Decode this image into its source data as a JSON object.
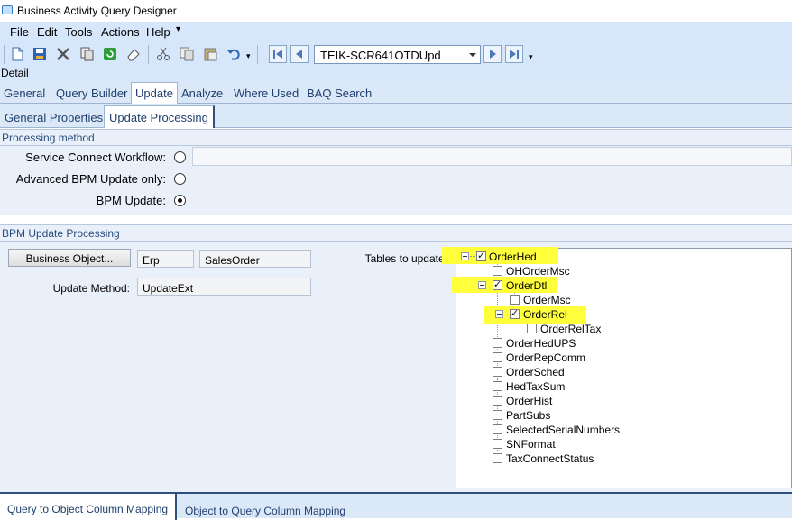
{
  "window": {
    "title": "Business Activity Query Designer"
  },
  "menu": [
    "File",
    "Edit",
    "Tools",
    "Actions",
    "Help"
  ],
  "toolbar": {
    "query_id": "TEIK-SCR641OTDUpd"
  },
  "detail_label": "Detail",
  "main_tabs": [
    "General",
    "Query Builder",
    "Update",
    "Analyze",
    "Where Used",
    "BAQ Search"
  ],
  "active_main_tab": "Update",
  "sub_tabs": [
    "General Properties",
    "Update Processing"
  ],
  "active_sub_tab": "Update Processing",
  "processing_method": {
    "header": "Processing method",
    "service_connect_label": "Service Connect Workflow:",
    "advanced_bpm_label": "Advanced BPM Update only:",
    "bpm_update_label": "BPM Update:",
    "selected": "BPM Update"
  },
  "bpm_update": {
    "header": "BPM Update Processing",
    "business_object_button": "Business Object...",
    "bo_namespace": "Erp",
    "bo_name": "SalesOrder",
    "update_method_label": "Update Method:",
    "update_method": "UpdateExt",
    "tables_label": "Tables to update:"
  },
  "tree": [
    {
      "label": "OrderHed",
      "checked": true,
      "highlight": true
    },
    {
      "label": "OHOrderMsc",
      "checked": false
    },
    {
      "label": "OrderDtl",
      "checked": true,
      "highlight": true
    },
    {
      "label": "OrderMsc",
      "checked": false
    },
    {
      "label": "OrderRel",
      "checked": true,
      "highlight": true
    },
    {
      "label": "OrderRelTax",
      "checked": false
    },
    {
      "label": "OrderHedUPS",
      "checked": false
    },
    {
      "label": "OrderRepComm",
      "checked": false
    },
    {
      "label": "OrderSched",
      "checked": false
    },
    {
      "label": "HedTaxSum",
      "checked": false
    },
    {
      "label": "OrderHist",
      "checked": false
    },
    {
      "label": "PartSubs",
      "checked": false
    },
    {
      "label": "SelectedSerialNumbers",
      "checked": false
    },
    {
      "label": "SNFormat",
      "checked": false
    },
    {
      "label": "TaxConnectStatus",
      "checked": false
    }
  ],
  "bottom_tabs": [
    "Query to Object Column Mapping",
    "Object to Query Column Mapping"
  ],
  "colors": {
    "highlight": "#ffff3c",
    "bar": "#d6e6fb",
    "panel": "#e9f0fa"
  },
  "icons": [
    "app-icon",
    "new-icon",
    "save-icon",
    "delete-icon",
    "copy-icon",
    "refresh-icon",
    "eraser-icon",
    "cut-icon",
    "copy-clip-icon",
    "paste-icon",
    "undo-icon",
    "first-icon",
    "prev-icon",
    "next-icon",
    "last-icon"
  ]
}
